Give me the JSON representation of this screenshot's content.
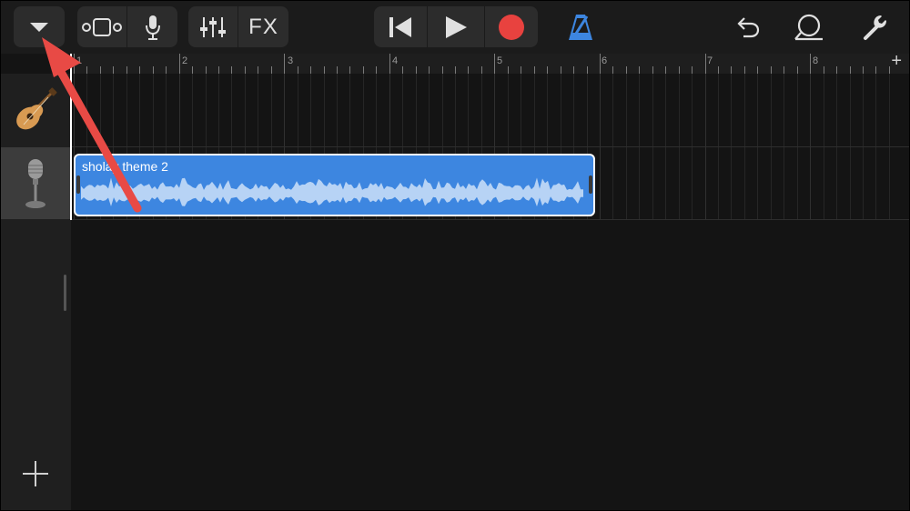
{
  "toolbar": {
    "browser_button_icon": "triangle-down-icon",
    "view_toggle_icon": "tracks-view-icon",
    "mic_icon": "microphone-icon",
    "mixer_icon": "sliders-icon",
    "fx_label": "FX",
    "rewind_icon": "skip-back-icon",
    "play_icon": "play-icon",
    "record_icon": "record-icon",
    "metronome_icon": "metronome-icon",
    "undo_icon": "undo-icon",
    "loop_icon": "loop-icon",
    "settings_icon": "wrench-icon",
    "colors": {
      "record": "#e8423f",
      "metronome": "#3d86e0",
      "accent": "#3d86e0"
    }
  },
  "ruler": {
    "bars": [
      "1",
      "2",
      "3",
      "4",
      "5",
      "6",
      "7",
      "8"
    ],
    "add_section_label": "+"
  },
  "tracks": [
    {
      "instrument": "acoustic-guitar-icon",
      "selected": false
    },
    {
      "instrument": "microphone-stand-icon",
      "selected": true
    }
  ],
  "region": {
    "title": "sholay theme 2",
    "color": "#3d86e0"
  },
  "sidebar": {
    "add_track_label": "+"
  },
  "annotation": {
    "arrow_color": "#e84a45"
  }
}
